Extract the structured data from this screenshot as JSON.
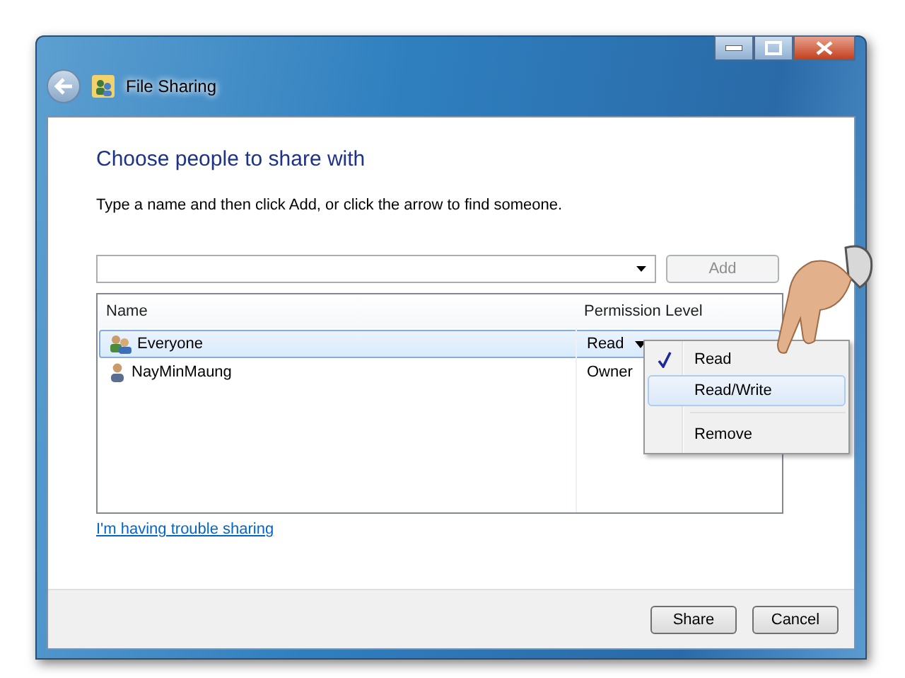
{
  "window": {
    "title": "File Sharing"
  },
  "heading": "Choose people to share with",
  "instruction": "Type a name and then click Add, or click the arrow to find someone.",
  "add_button": {
    "label": "Add",
    "disabled": true
  },
  "table": {
    "columns": [
      "Name",
      "Permission Level"
    ],
    "rows": [
      {
        "name": "Everyone",
        "kind": "group",
        "permission": "Read",
        "selected": true
      },
      {
        "name": "NayMinMaung",
        "kind": "user",
        "permission": "Owner",
        "selected": false
      }
    ]
  },
  "permission_menu": {
    "items": [
      {
        "kind": "option",
        "label": "Read",
        "checked": true,
        "highlighted": false
      },
      {
        "kind": "option",
        "label": "Read/Write",
        "checked": false,
        "highlighted": true
      },
      {
        "kind": "separator"
      },
      {
        "kind": "option",
        "label": "Remove",
        "checked": false,
        "highlighted": false
      }
    ]
  },
  "link": "I'm having trouble sharing",
  "buttons": [
    "Share",
    "Cancel"
  ]
}
